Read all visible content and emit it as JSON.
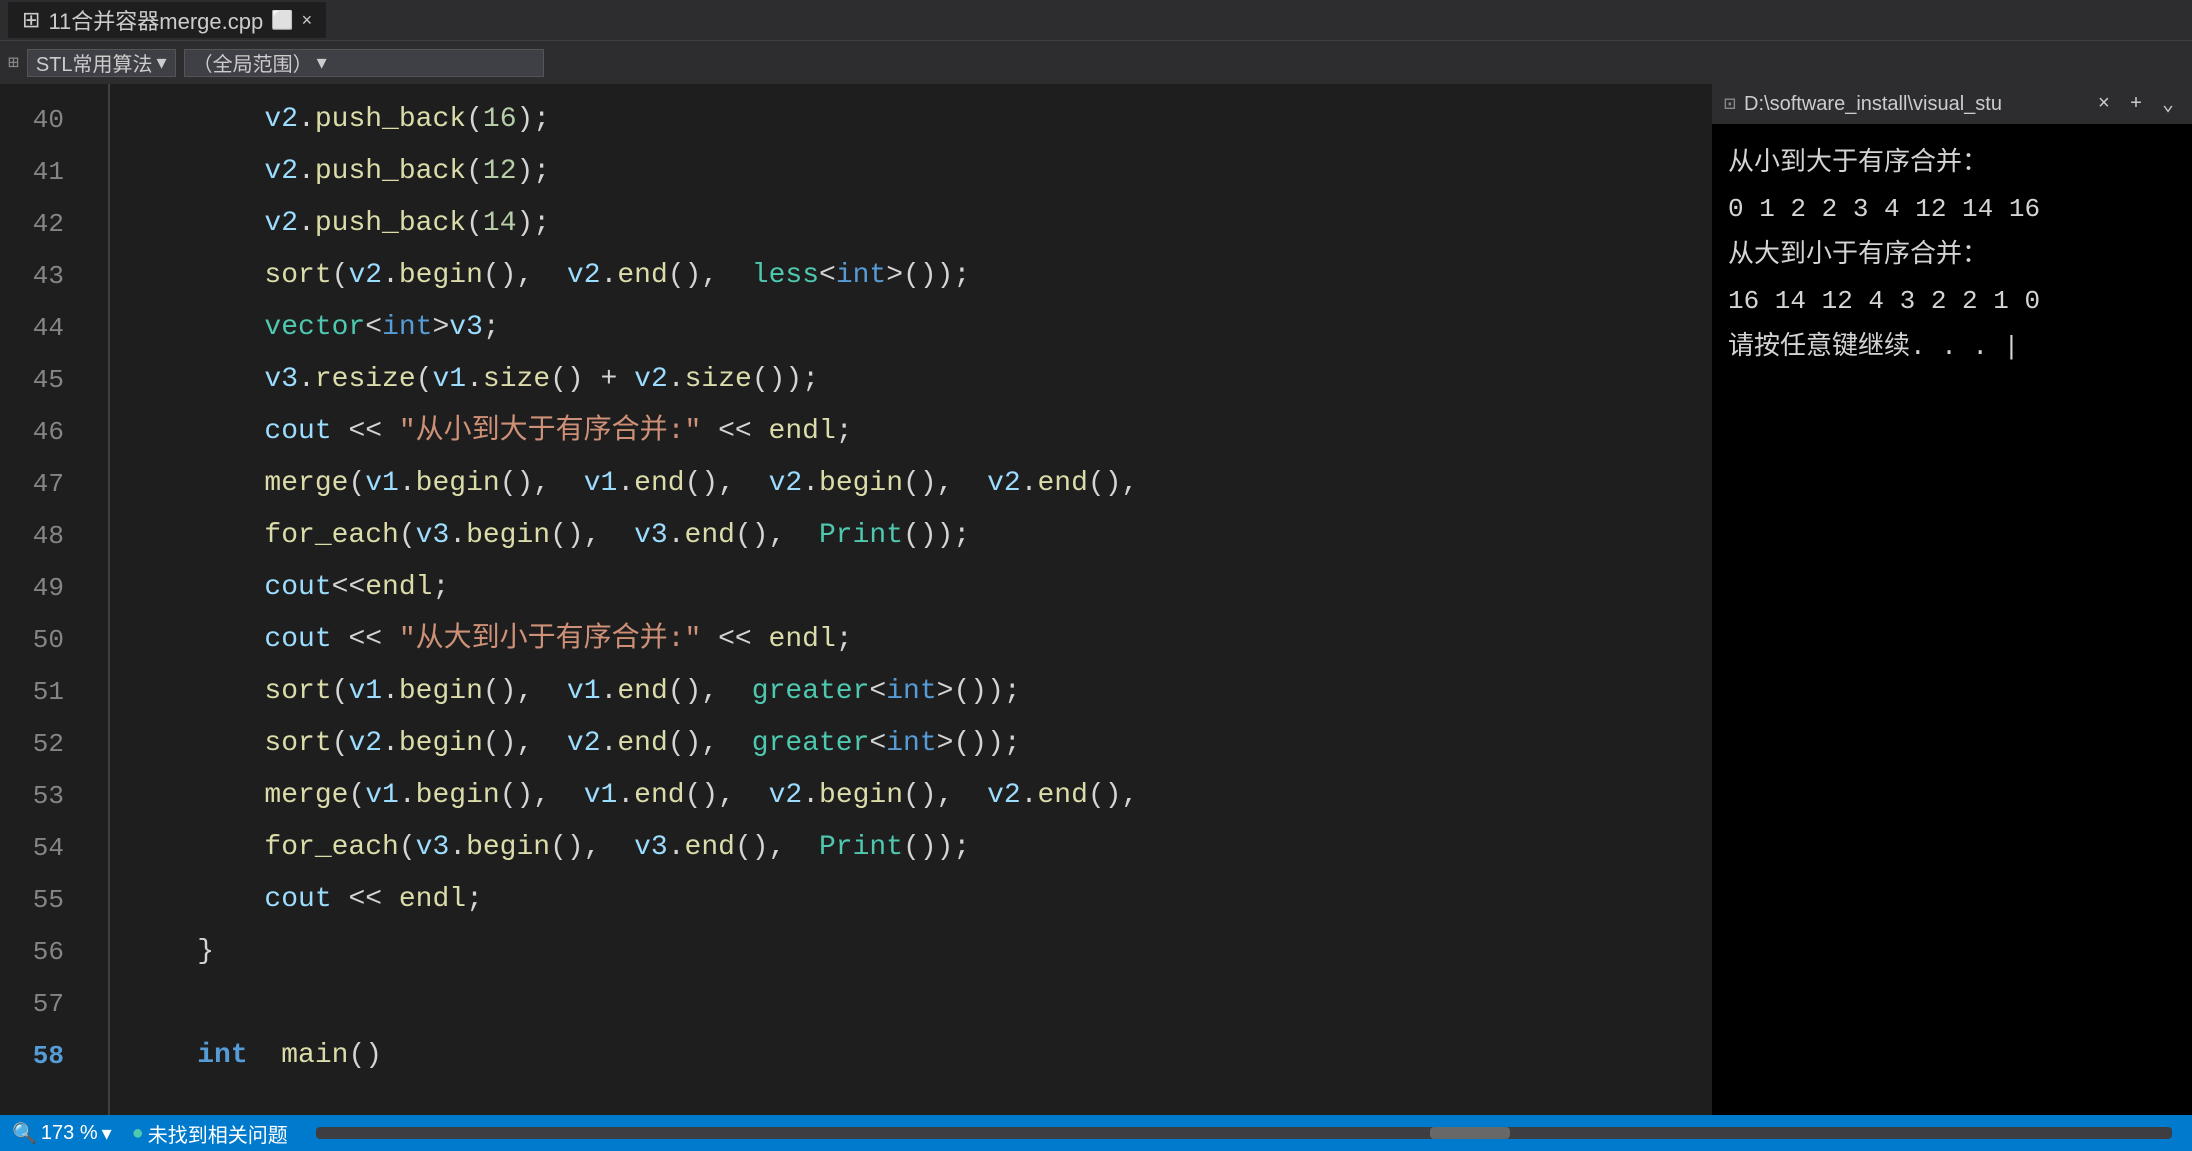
{
  "titlebar": {
    "tab_label": "11合并容器merge.cpp",
    "tab_icon": "⊞",
    "close_icon": "×"
  },
  "toolbar": {
    "icon": "⊞",
    "dropdown1_value": "STL常用算法",
    "dropdown1_arrow": "▾",
    "dropdown2_value": "（全局范围）",
    "dropdown2_arrow": "▾"
  },
  "code_lines": [
    {
      "num": "40",
      "content": "v2.push_back(16);"
    },
    {
      "num": "41",
      "content": "v2.push_back(12);"
    },
    {
      "num": "42",
      "content": "v2.push_back(14);"
    },
    {
      "num": "43",
      "content": "sort(v2.begin(),  v2.end(),  less<int>());"
    },
    {
      "num": "44",
      "content": "vector<int>v3;"
    },
    {
      "num": "45",
      "content": "v3.resize(v1.size() + v2.size());"
    },
    {
      "num": "46",
      "content": "cout << \"从小到大于有序合并:\" << endl;"
    },
    {
      "num": "47",
      "content": "merge(v1.begin(),  v1.end(),  v2.begin(),  v2.end(),"
    },
    {
      "num": "48",
      "content": "for_each(v3.begin(),  v3.end(),  Print());"
    },
    {
      "num": "49",
      "content": "cout<<endl;"
    },
    {
      "num": "50",
      "content": "cout << \"从大到小于有序合并:\" << endl;"
    },
    {
      "num": "51",
      "content": "sort(v1.begin(),  v1.end(),  greater<int>());"
    },
    {
      "num": "52",
      "content": "sort(v2.begin(),  v2.end(),  greater<int>());"
    },
    {
      "num": "53",
      "content": "merge(v1.begin(),  v1.end(),  v2.begin(),  v2.end(),"
    },
    {
      "num": "54",
      "content": "for_each(v3.begin(),  v3.end(),  Print());"
    },
    {
      "num": "55",
      "content": "cout << endl;"
    },
    {
      "num": "56",
      "content": "}"
    },
    {
      "num": "57",
      "content": ""
    },
    {
      "num": "58",
      "content": "int  main()"
    }
  ],
  "terminal": {
    "title": "D:\\software_install\\visual_stu",
    "icon": "⊡",
    "close_icon": "×",
    "add_icon": "+",
    "menu_icon": "⌄",
    "lines": [
      "从小到大于有序合并：",
      "0 1 2 2 3 4 12 14 16",
      "从大到小于有序合并：",
      "16 14 12 4 3 2 2 1 0",
      "请按任意键继续. . . |"
    ]
  },
  "statusbar": {
    "zoom": "173 %",
    "zoom_icon": "🔍",
    "status_icon": "●",
    "status_text": "未找到相关问题",
    "scroll_label": "◄"
  }
}
